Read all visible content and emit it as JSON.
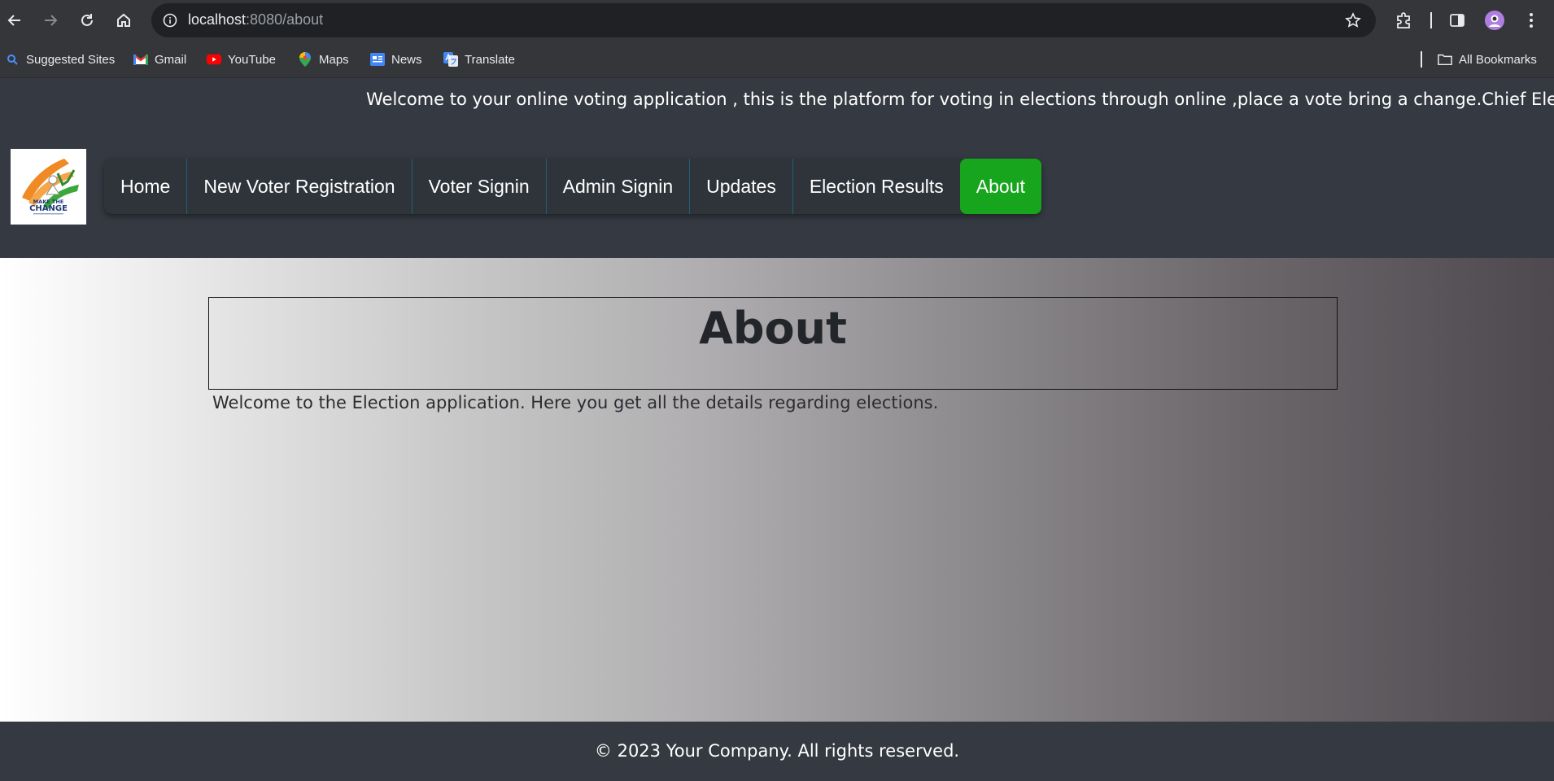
{
  "browser": {
    "url_host": "localhost",
    "url_rest": ":8080/about",
    "bookmarks": [
      {
        "label": "Suggested Sites",
        "icon": "search-icon"
      },
      {
        "label": "Gmail",
        "icon": "gmail-icon"
      },
      {
        "label": "YouTube",
        "icon": "youtube-icon"
      },
      {
        "label": "Maps",
        "icon": "maps-icon"
      },
      {
        "label": "News",
        "icon": "news-icon"
      },
      {
        "label": "Translate",
        "icon": "translate-icon"
      }
    ],
    "all_bookmarks": "All Bookmarks"
  },
  "header": {
    "marquee": "Welcome to your online voting application , this is the platform for voting in elections through online ,place a vote bring a change.Chief Electoral C",
    "logo": {
      "line1": "MAKE THE",
      "line2": "CHANGE"
    },
    "nav": [
      {
        "label": "Home"
      },
      {
        "label": "New Voter Registration"
      },
      {
        "label": "Voter Signin"
      },
      {
        "label": "Admin Signin"
      },
      {
        "label": "Updates"
      },
      {
        "label": "Election Results"
      },
      {
        "label": "About",
        "active": true
      }
    ]
  },
  "main": {
    "title": "About",
    "text": "Welcome to the Election application. Here you get all the details regarding elections."
  },
  "footer": {
    "text": "© 2023 Your Company. All rights reserved."
  },
  "colors": {
    "active_nav": "#16a51c",
    "header_bg": "#353a42"
  }
}
